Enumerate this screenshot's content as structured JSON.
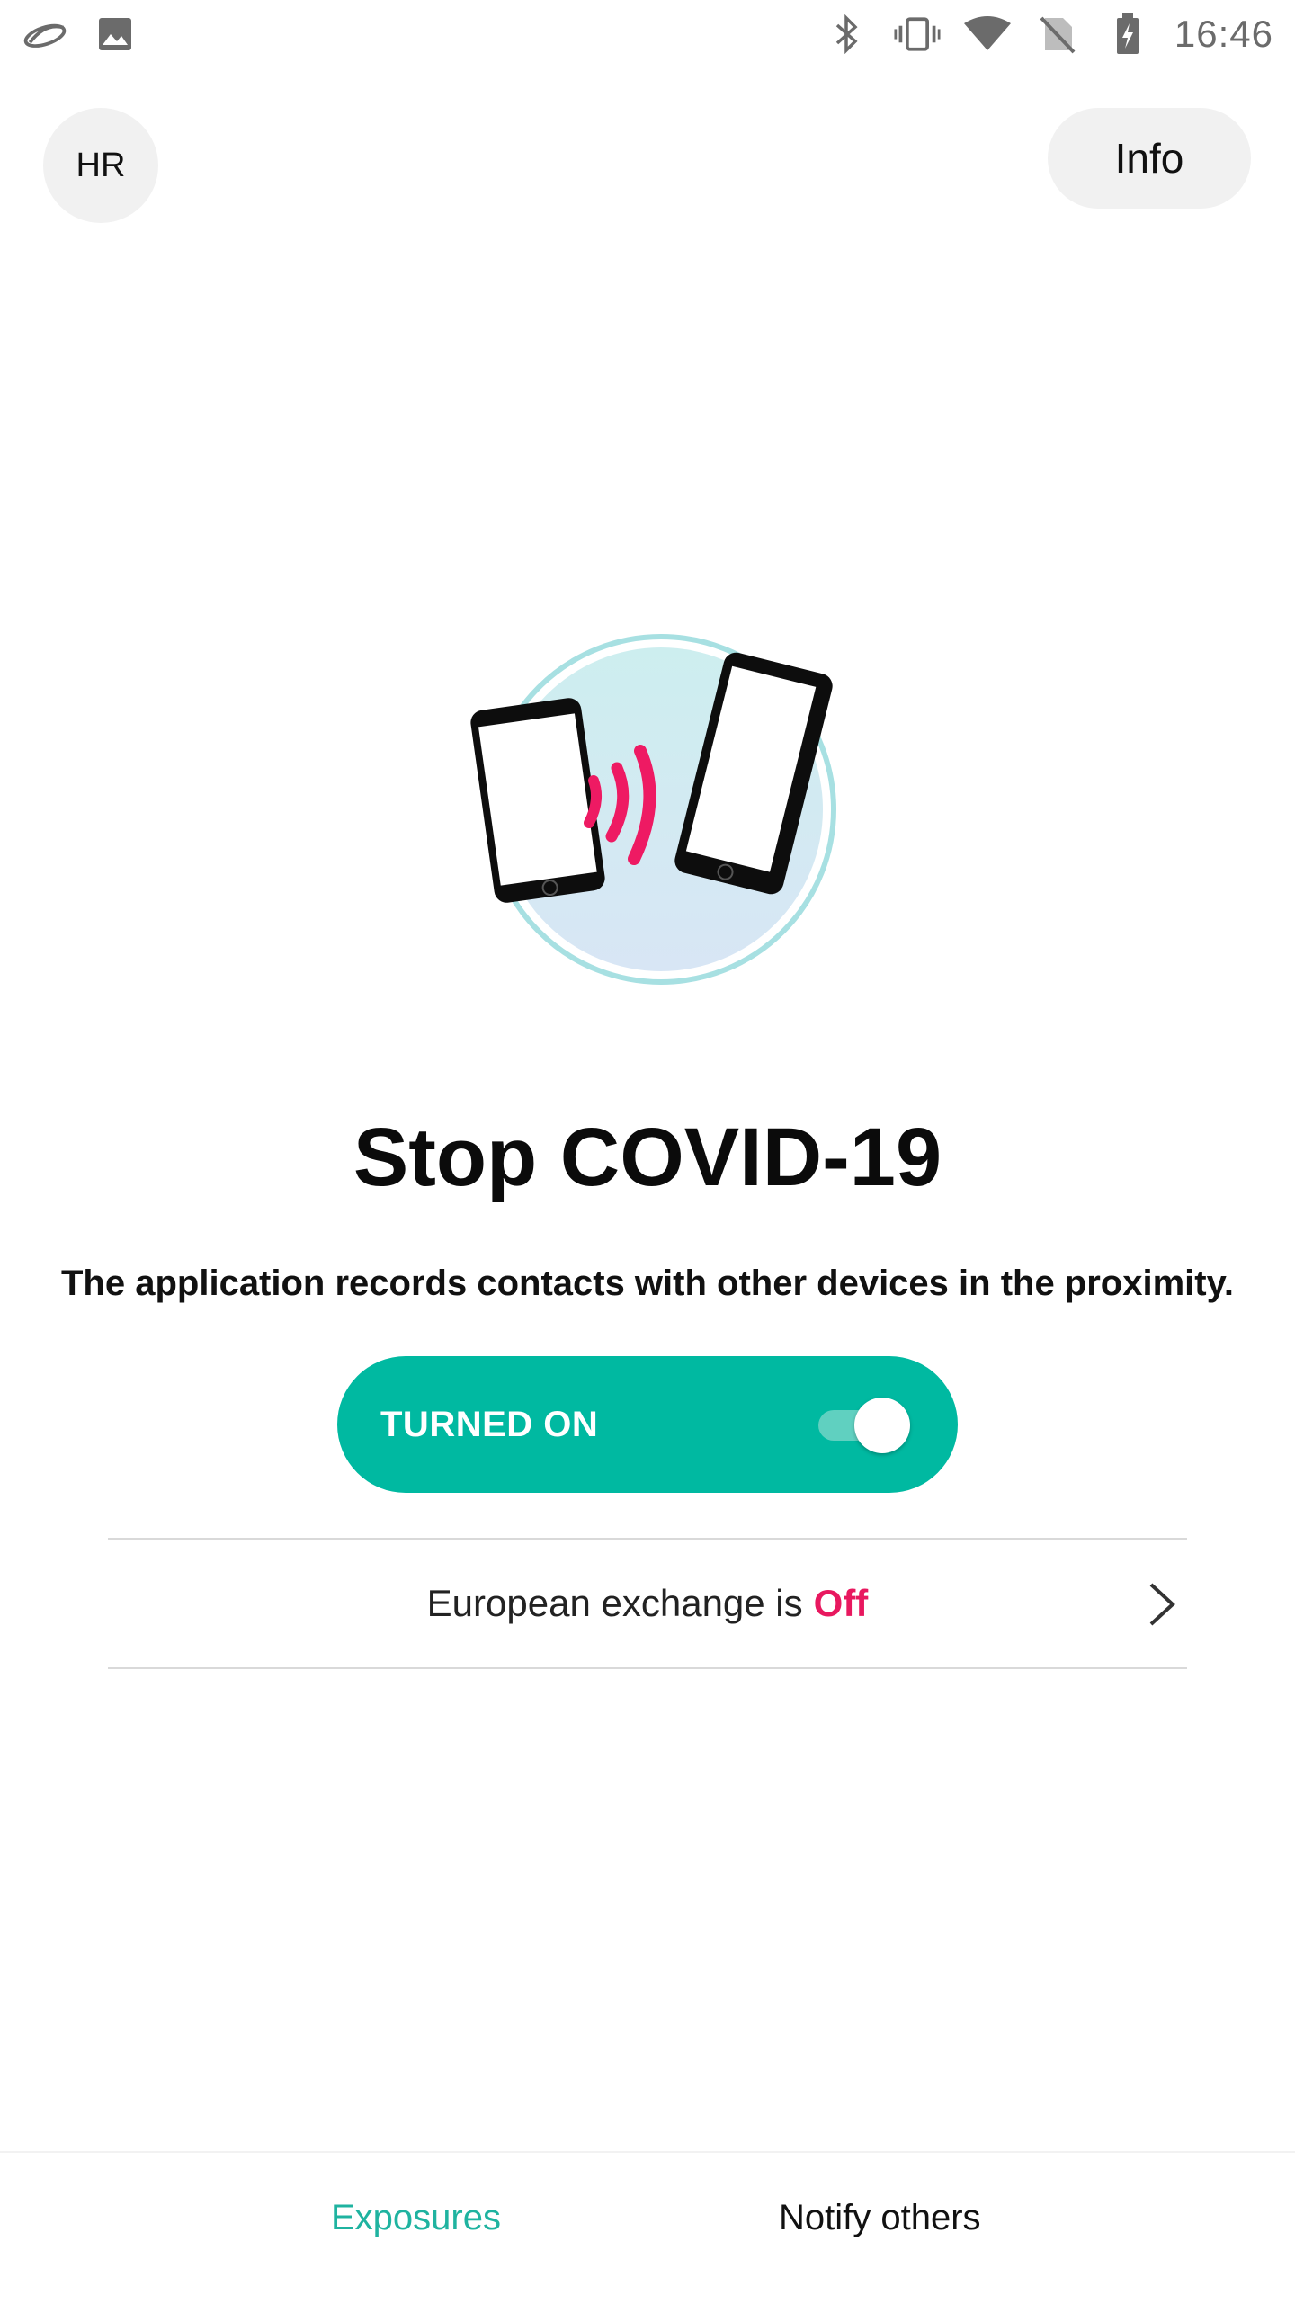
{
  "status_bar": {
    "time": "16:46",
    "left_icons": [
      "cloud-app-icon",
      "image-icon"
    ],
    "right_icons": [
      "bluetooth-icon",
      "vibrate-icon",
      "wifi-icon",
      "no-sim-icon",
      "battery-charging-icon"
    ]
  },
  "header": {
    "language_label": "HR",
    "info_label": "Info"
  },
  "main": {
    "title": "Stop COVID-19",
    "subtitle": "The application records contacts with other devices in the proximity.",
    "toggle": {
      "label": "TURNED ON",
      "state": "on"
    },
    "exchange": {
      "text": "European exchange is",
      "status": "Off"
    }
  },
  "bottom_nav": {
    "items": [
      {
        "label": "Exposures",
        "active": true
      },
      {
        "label": "Notify others",
        "active": false
      }
    ]
  },
  "colors": {
    "accent": "#00b9a1",
    "nav_active": "#1fb3a0",
    "status_off": "#e8185f",
    "pill_background": "#f1f1f1"
  }
}
